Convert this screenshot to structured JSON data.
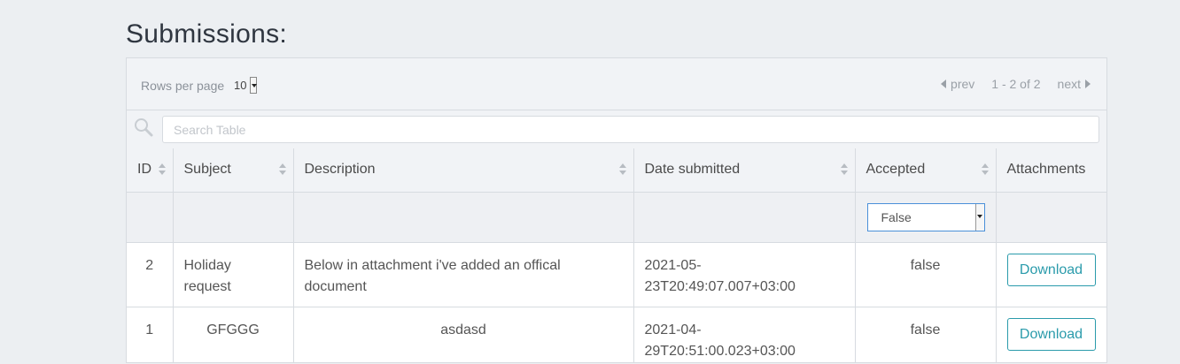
{
  "page": {
    "title": "Submissions:"
  },
  "pagination": {
    "rows_label": "Rows per page",
    "rows_value": "10",
    "prev_label": "prev",
    "info": "1 - 2 of 2",
    "next_label": "next"
  },
  "search": {
    "placeholder": "Search Table"
  },
  "columns": [
    {
      "label": "ID",
      "sortable": true
    },
    {
      "label": "Subject",
      "sortable": true
    },
    {
      "label": "Description",
      "sortable": true
    },
    {
      "label": "Date submitted",
      "sortable": true
    },
    {
      "label": "Accepted",
      "sortable": true
    },
    {
      "label": "Attachments",
      "sortable": false
    }
  ],
  "filter": {
    "accepted_value": "False"
  },
  "rows": [
    {
      "id": "2",
      "subject": "Holiday request",
      "description": "Below in attachment i've added an offical document",
      "date": "2021-05-23T20:49:07.007+03:00",
      "accepted": "false",
      "action": "Download"
    },
    {
      "id": "1",
      "subject": "GFGGG",
      "description": "asdasd",
      "date": "2021-04-29T20:51:00.023+03:00",
      "accepted": "false",
      "action": "Download"
    }
  ],
  "colors": {
    "accent": "#2a9bab",
    "border": "#d7dbe0",
    "background": "#eceff2"
  }
}
